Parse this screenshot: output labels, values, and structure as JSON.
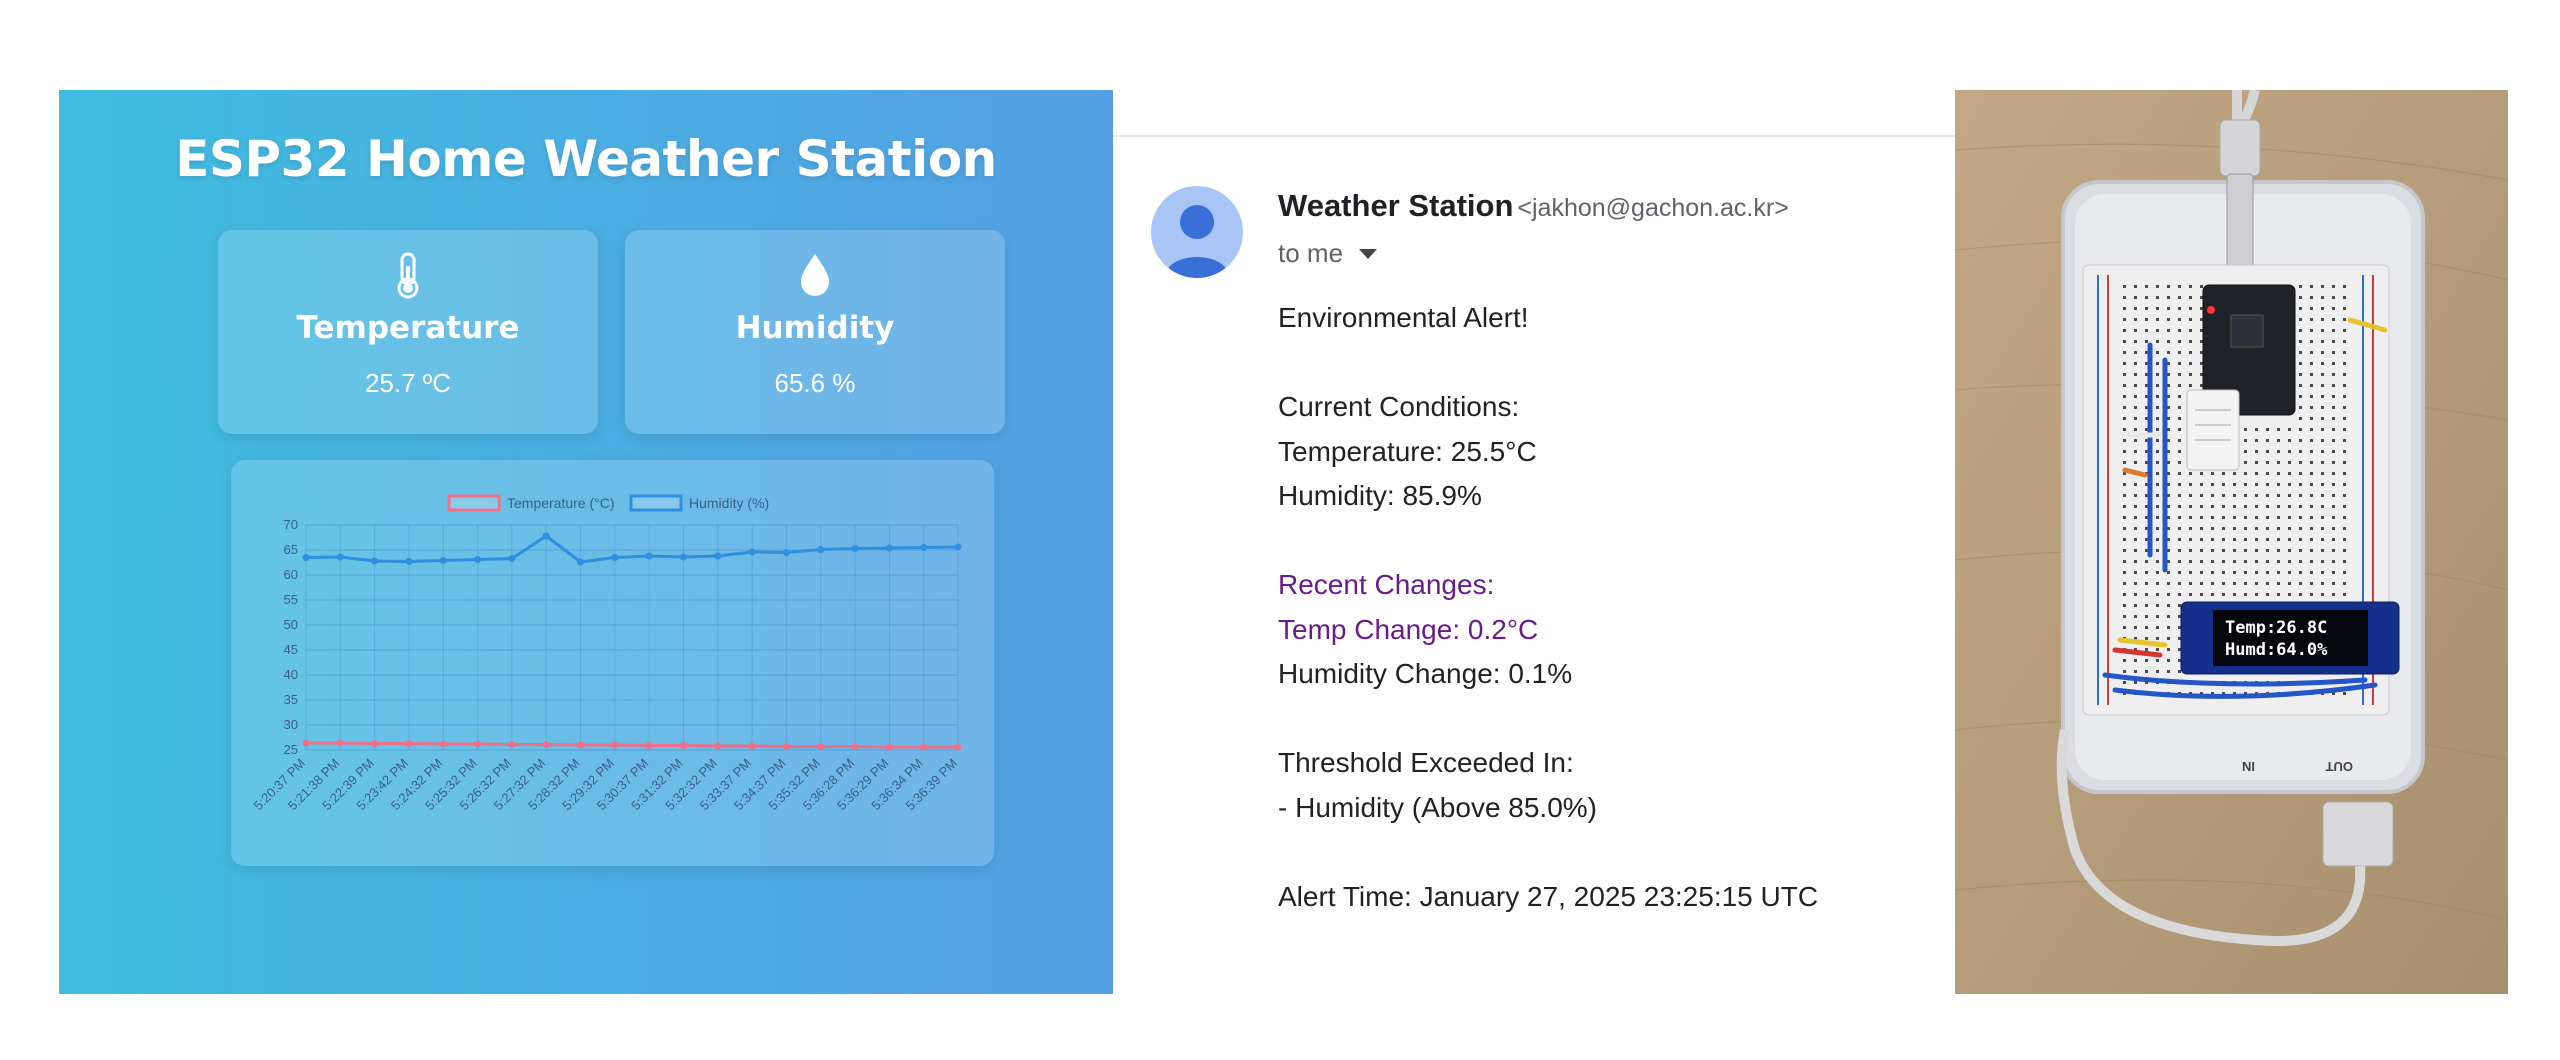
{
  "dashboard": {
    "title": "ESP32 Home Weather Station",
    "temperature": {
      "label": "Temperature",
      "value": "25.7 ºC",
      "icon": "thermometer-icon"
    },
    "humidity": {
      "label": "Humidity",
      "value": "65.6 %",
      "icon": "droplet-icon"
    }
  },
  "chart_data": {
    "type": "line",
    "x": [
      "5:20:37 PM",
      "5:21:38 PM",
      "5:22:39 PM",
      "5:23:42 PM",
      "5:24:32 PM",
      "5:25:32 PM",
      "5:26:32 PM",
      "5:27:32 PM",
      "5:28:32 PM",
      "5:29:32 PM",
      "5:30:37 PM",
      "5:31:32 PM",
      "5:32:32 PM",
      "5:33:37 PM",
      "5:34:37 PM",
      "5:35:32 PM",
      "5:36:28 PM",
      "5:36:29 PM",
      "5:36:34 PM",
      "5:36:39 PM"
    ],
    "series": [
      {
        "name": "Temperature (°C)",
        "color": "#f0708a",
        "values": [
          26.4,
          26.4,
          26.3,
          26.3,
          26.2,
          26.2,
          26.1,
          26.1,
          26.0,
          26.0,
          25.9,
          25.9,
          25.8,
          25.8,
          25.7,
          25.7,
          25.7,
          25.6,
          25.6,
          25.6
        ]
      },
      {
        "name": "Humidity (%)",
        "color": "#2f8fe0",
        "values": [
          63.5,
          63.6,
          62.8,
          62.7,
          62.9,
          63.1,
          63.3,
          67.8,
          62.6,
          63.5,
          63.8,
          63.6,
          63.8,
          64.6,
          64.5,
          65.1,
          65.3,
          65.4,
          65.5,
          65.6
        ]
      }
    ],
    "ylim": [
      25,
      70
    ],
    "yticks": [
      25,
      30,
      35,
      40,
      45,
      50,
      55,
      60,
      65,
      70
    ],
    "legend": "top-center",
    "grid": true
  },
  "email": {
    "sender_name": "Weather Station",
    "sender_address": "<jakhon@gachon.ac.kr>",
    "to_label": "to me",
    "lines": [
      {
        "text": "Environmental Alert!",
        "color": "default"
      },
      {
        "text": "",
        "color": "default"
      },
      {
        "text": "Current Conditions:",
        "color": "default"
      },
      {
        "text": "Temperature: 25.5°C",
        "color": "default"
      },
      {
        "text": "Humidity: 85.9%",
        "color": "default"
      },
      {
        "text": "",
        "color": "default"
      },
      {
        "text": "Recent Changes:",
        "color": "purple"
      },
      {
        "text": "Temp Change: 0.2°C",
        "color": "purple"
      },
      {
        "text": "Humidity Change: 0.1%",
        "color": "default"
      },
      {
        "text": "",
        "color": "default"
      },
      {
        "text": "Threshold Exceeded In:",
        "color": "default"
      },
      {
        "text": "- Humidity (Above 85.0%)",
        "color": "default"
      },
      {
        "text": "",
        "color": "default"
      },
      {
        "text": "Alert Time: January 27, 2025 23:25:15 UTC",
        "color": "default"
      }
    ]
  },
  "photo": {
    "oled_line1": "Temp:26.8C",
    "oled_line2": "Humd:64.0%",
    "port_in": "IN",
    "port_out": "OUT"
  }
}
